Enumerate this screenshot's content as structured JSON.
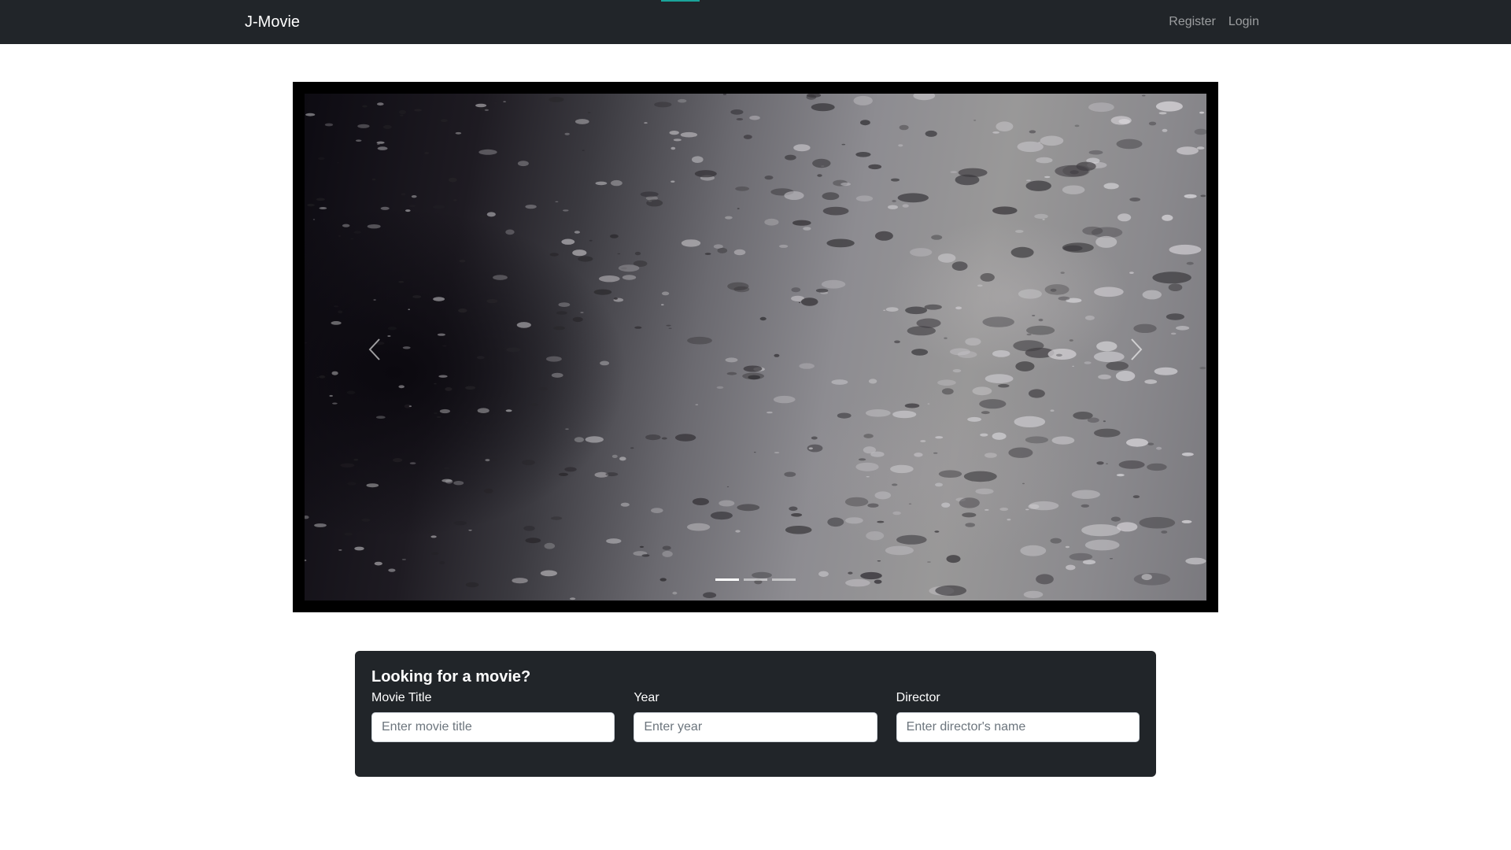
{
  "navbar": {
    "brand": "J-Movie",
    "links": [
      {
        "label": "Register"
      },
      {
        "label": "Login"
      }
    ],
    "colors": {
      "background": "#212529",
      "progress": "#1aa39a"
    }
  },
  "carousel": {
    "slide_count": 3,
    "active_slide": 1,
    "prev_icon": "chevron-left-icon",
    "next_icon": "chevron-right-icon"
  },
  "search": {
    "title": "Looking for a movie?",
    "fields": [
      {
        "label": "Movie Title",
        "placeholder": "Enter movie title",
        "value": ""
      },
      {
        "label": "Year",
        "placeholder": "Enter year",
        "value": ""
      },
      {
        "label": "Director",
        "placeholder": "Enter director's name",
        "value": ""
      }
    ]
  }
}
